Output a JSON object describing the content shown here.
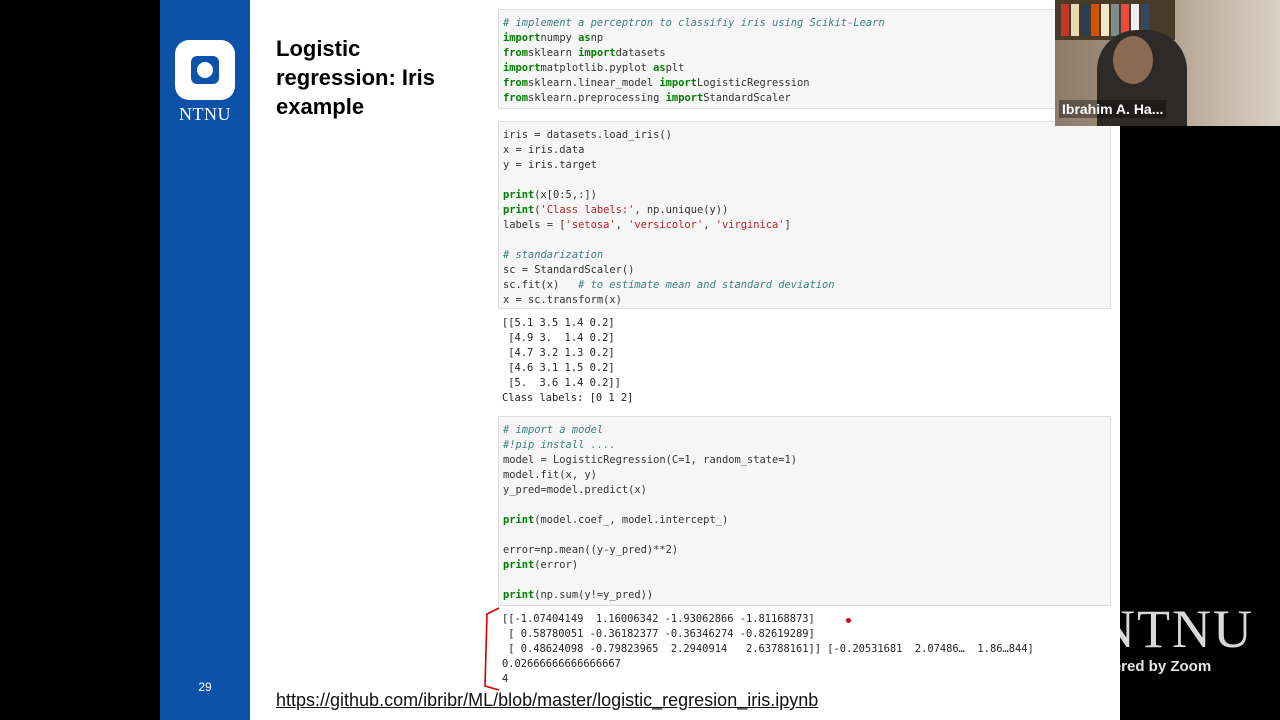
{
  "sidebar": {
    "logo_text": "NTNU",
    "page_number": "29"
  },
  "slide": {
    "title": "Logistic regression: Iris example",
    "link": "https://github.com/ibribr/ML/blob/master/logistic_regresion_iris.ipynb"
  },
  "cells": [
    [
      [
        [
          "cm",
          "# implement a perceptron to classifiy iris using Scikit-Learn"
        ]
      ],
      [
        [
          "kw",
          "import"
        ],
        [
          "",
          "numpy "
        ],
        [
          "kw",
          "as"
        ],
        [
          "",
          "np"
        ]
      ],
      [
        [
          "kw",
          "from"
        ],
        [
          "",
          "sklearn "
        ],
        [
          "kw",
          "import"
        ],
        [
          "",
          "datasets"
        ]
      ],
      [
        [
          "kw",
          "import"
        ],
        [
          "",
          "matplotlib.pyplot "
        ],
        [
          "kw",
          "as"
        ],
        [
          "",
          "plt"
        ]
      ],
      [
        [
          "kw",
          "from"
        ],
        [
          "",
          "sklearn.linear_model "
        ],
        [
          "kw",
          "import"
        ],
        [
          "",
          "LogisticRegression"
        ]
      ],
      [
        [
          "kw",
          "from"
        ],
        [
          "",
          "sklearn.preprocessing "
        ],
        [
          "kw",
          "import"
        ],
        [
          "",
          "StandardScaler"
        ]
      ]
    ],
    [
      [
        [
          "",
          "iris = datasets.load_iris()"
        ]
      ],
      [
        [
          "",
          "x = iris.data"
        ]
      ],
      [
        [
          "",
          "y = iris.target"
        ]
      ],
      [],
      [
        [
          "kw",
          "print"
        ],
        [
          "",
          "(x[0:5,:])"
        ]
      ],
      [
        [
          "kw",
          "print"
        ],
        [
          "",
          "("
        ],
        [
          "st",
          "'Class labels:'"
        ],
        [
          "",
          ", np.unique(y))"
        ]
      ],
      [
        [
          "",
          "labels = ["
        ],
        [
          "st",
          "'setosa'"
        ],
        [
          "",
          ", "
        ],
        [
          "st",
          "'versicolor'"
        ],
        [
          "",
          ", "
        ],
        [
          "st",
          "'virginica'"
        ],
        [
          "",
          "]"
        ]
      ],
      [],
      [
        [
          "cm",
          "# standarization"
        ]
      ],
      [
        [
          "",
          "sc = StandardScaler()"
        ]
      ],
      [
        [
          "",
          "sc.fit(x)   "
        ],
        [
          "cm",
          "# to estimate mean and standard deviation"
        ]
      ],
      [
        [
          "",
          "x = sc.transform(x)"
        ]
      ]
    ],
    [
      [
        [
          "cm",
          "# import a model"
        ]
      ],
      [
        [
          "cm",
          "#!pip install ...."
        ]
      ],
      [
        [
          "",
          "model = LogisticRegression(C=1, random_state=1)"
        ]
      ],
      [
        [
          "",
          "model.fit(x, y)"
        ]
      ],
      [
        [
          "",
          "y_pred=model.predict(x)"
        ]
      ],
      [],
      [
        [
          "kw",
          "print"
        ],
        [
          "",
          "(model.coef_, model.intercept_)"
        ]
      ],
      [],
      [
        [
          "",
          "error=np.mean((y-y_pred)**2)"
        ]
      ],
      [
        [
          "kw",
          "print"
        ],
        [
          "",
          "(error)"
        ]
      ],
      [],
      [
        [
          "kw",
          "print"
        ],
        [
          "",
          "(np.sum(y!=y_pred))"
        ]
      ]
    ]
  ],
  "outputs": {
    "out1": "[[5.1 3.5 1.4 0.2]\n [4.9 3.  1.4 0.2]\n [4.7 3.2 1.3 0.2]\n [4.6 3.1 1.5 0.2]\n [5.  3.6 1.4 0.2]]\nClass labels: [0 1 2]",
    "out2": "[[-1.07404149  1.16006342 -1.93062866 -1.81168873]\n [ 0.58780051 -0.36182377 -0.36346274 -0.82619289]\n [ 0.48624098 -0.79823965  2.2940914   2.63788161]] [-0.20531681  2.07486…  1.86…844]\n0.02666666666666667\n4"
  },
  "webcam": {
    "name": "Ibrahim A. Ha..."
  },
  "zoom": {
    "watermark": "NTNU",
    "powered": "Powered by Zoom"
  }
}
